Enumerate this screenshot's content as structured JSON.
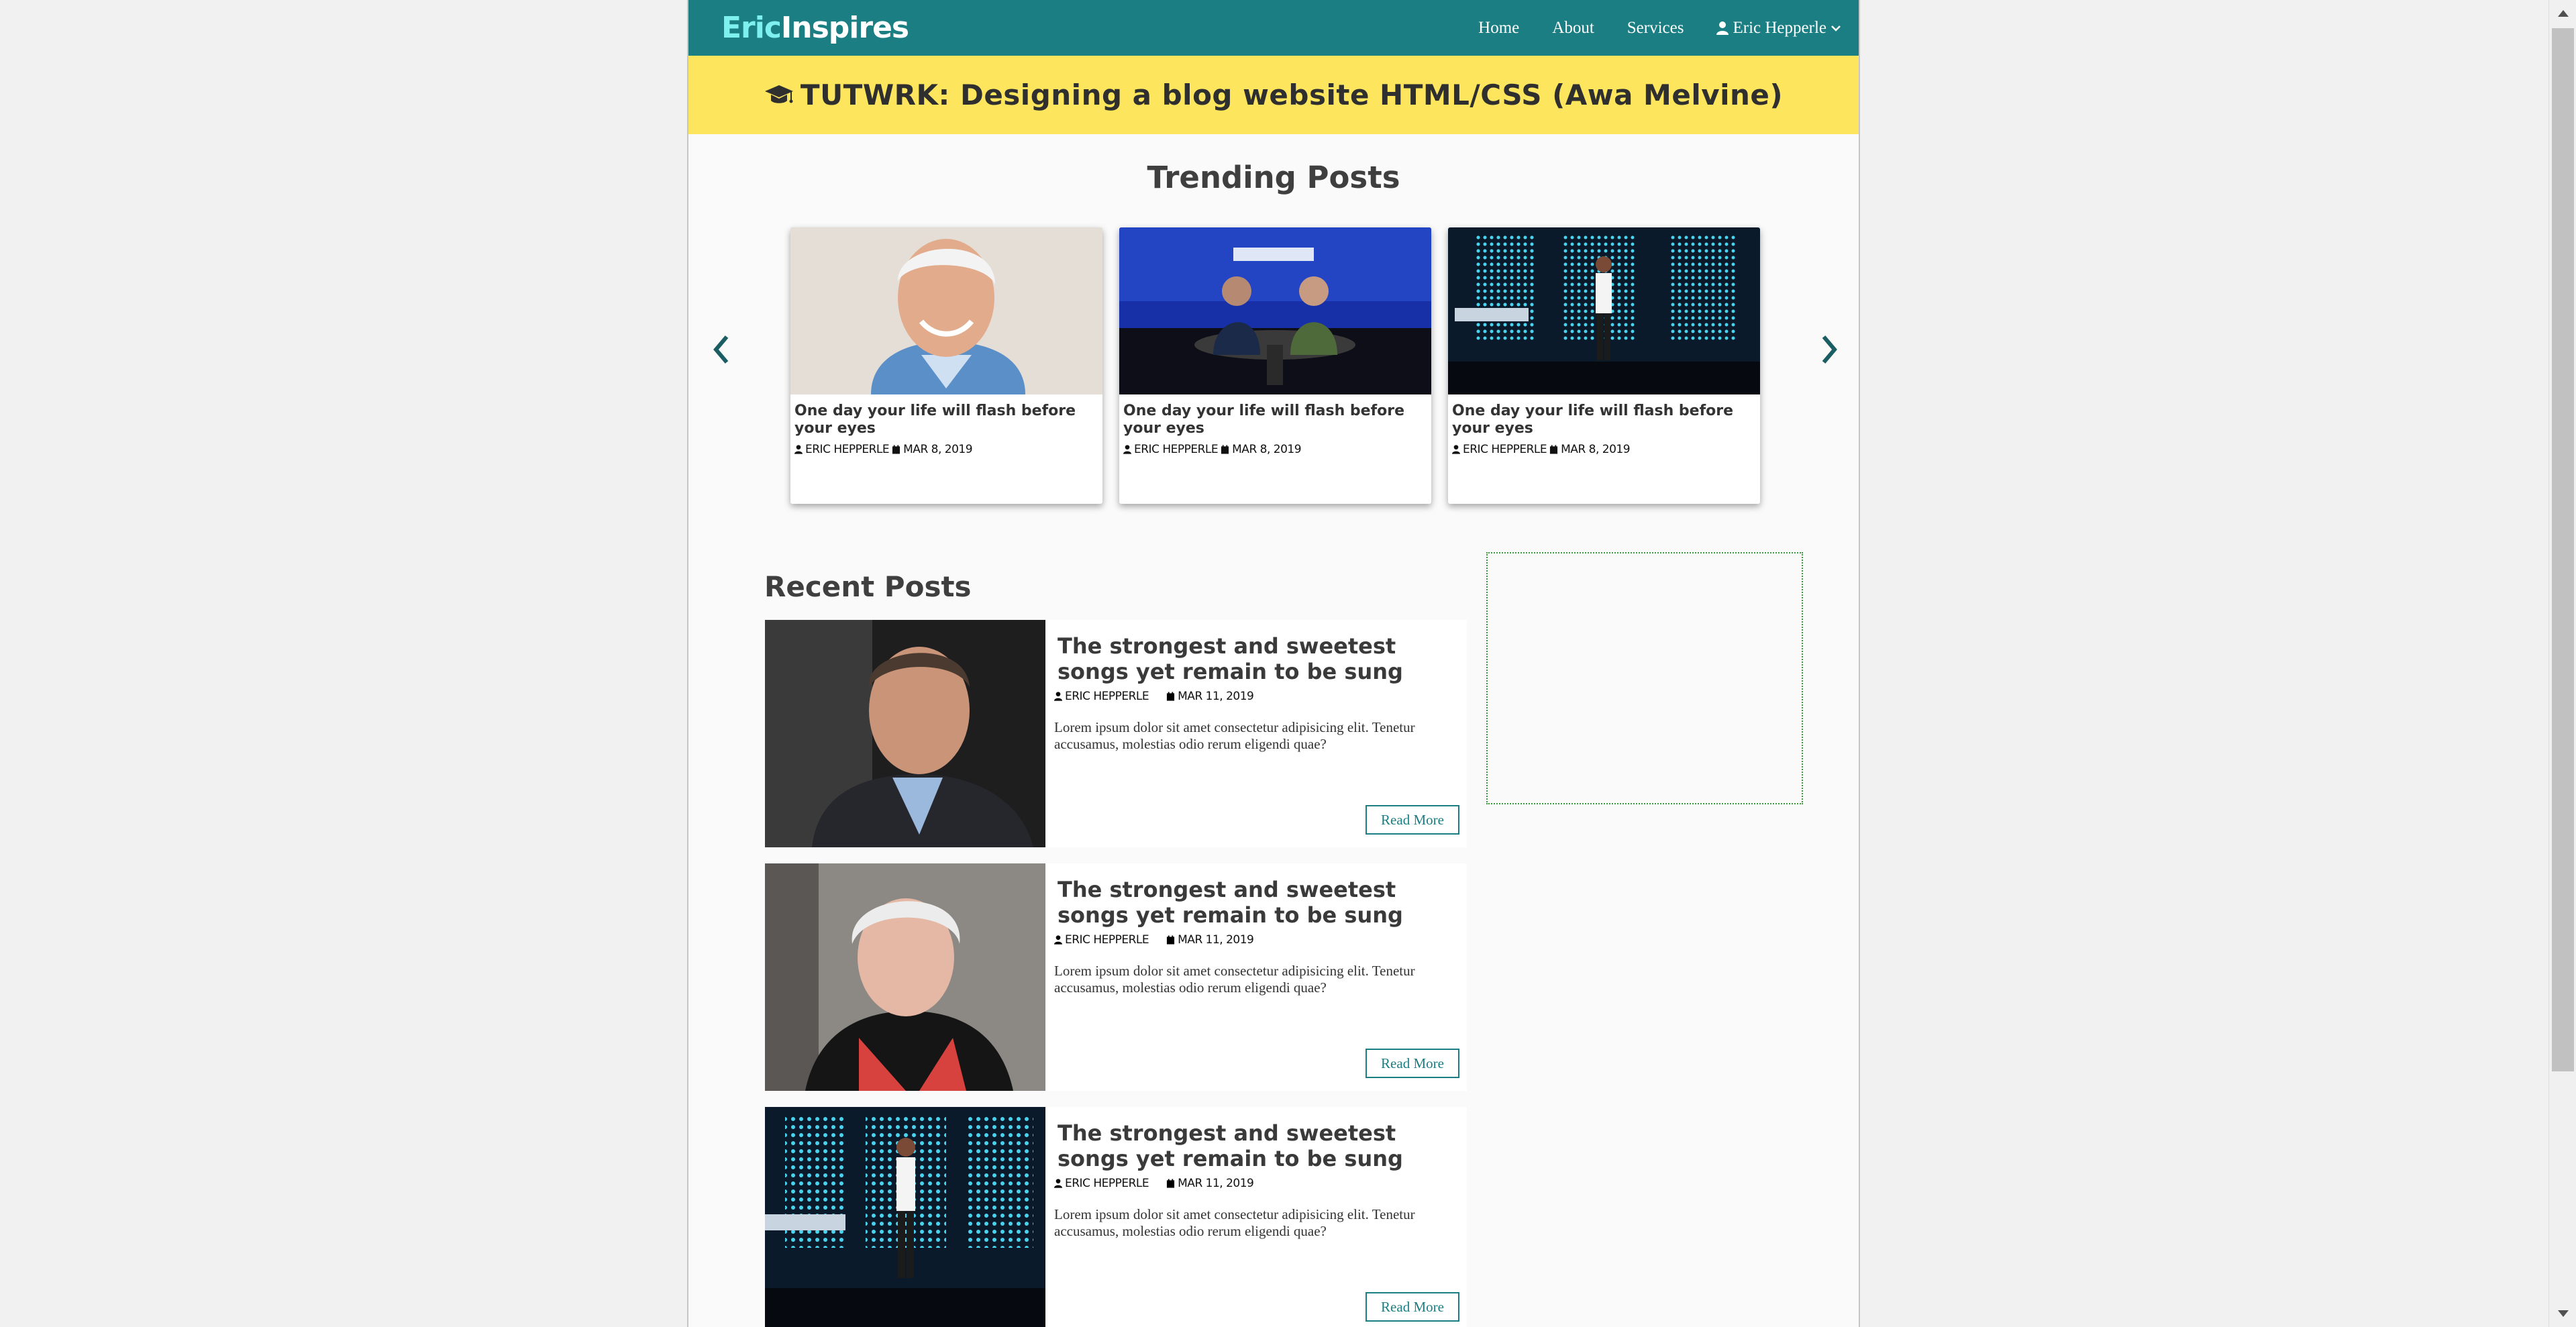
{
  "nav": {
    "logo_part1": "Eric",
    "logo_part2": "Inspires",
    "links": [
      "Home",
      "About",
      "Services"
    ],
    "user_name": "Eric Hepperle"
  },
  "banner": {
    "text": "TUTWRK: Designing a blog website HTML/CSS (Awa Melvine)"
  },
  "trending": {
    "title": "Trending Posts",
    "cards": [
      {
        "title": "One day your life will flash before your eyes",
        "author": "ERIC HEPPERLE",
        "date": "MAR 8, 2019"
      },
      {
        "title": "One day your life will flash before your eyes",
        "author": "ERIC HEPPERLE",
        "date": "MAR 8, 2019"
      },
      {
        "title": "One day your life will flash before your eyes",
        "author": "ERIC HEPPERLE",
        "date": "MAR 8, 2019"
      }
    ]
  },
  "recent": {
    "title": "Recent Posts",
    "posts": [
      {
        "title": "The strongest and sweetest songs yet remain to be sung",
        "author": "ERIC HEPPERLE",
        "date": "MAR 11, 2019",
        "excerpt": "Lorem ipsum dolor sit amet consectetur adipisicing elit. Tenetur accusamus, molestias odio rerum eligendi quae?",
        "button": "Read More"
      },
      {
        "title": "The strongest and sweetest songs yet remain to be sung",
        "author": "ERIC HEPPERLE",
        "date": "MAR 11, 2019",
        "excerpt": "Lorem ipsum dolor sit amet consectetur adipisicing elit. Tenetur accusamus, molestias odio rerum eligendi quae?",
        "button": "Read More"
      },
      {
        "title": "The strongest and sweetest songs yet remain to be sung",
        "author": "ERIC HEPPERLE",
        "date": "MAR 11, 2019",
        "excerpt": "Lorem ipsum dolor sit amet consectetur adipisicing elit. Tenetur accusamus, molestias odio rerum eligendi quae?",
        "button": "Read More"
      }
    ]
  },
  "colors": {
    "nav": "#1a7e83",
    "banner": "#fde65e",
    "logo_accent": "#7ef0ee"
  }
}
